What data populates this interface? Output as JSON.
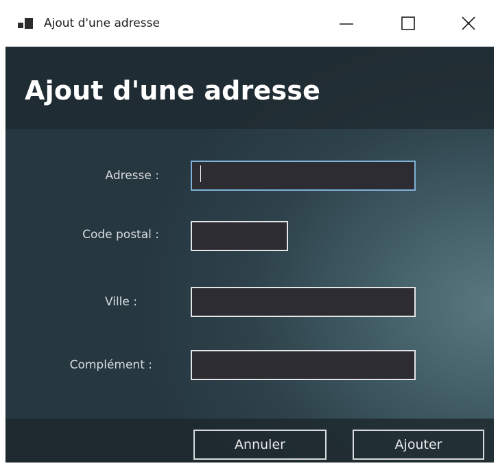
{
  "window": {
    "title": "Ajout d'une adresse",
    "icon": "app-window-icon",
    "controls": {
      "minimize": "minimize-icon",
      "maximize": "maximize-icon",
      "close": "close-icon"
    }
  },
  "header": {
    "title": "Ajout d'une adresse"
  },
  "form": {
    "address_label": "Adresse :",
    "address_value": "",
    "postal_label": "Code postal :",
    "postal_value": "",
    "city_label": "Ville :",
    "city_value": "",
    "complement_label": "Complément :",
    "complement_value": ""
  },
  "footer": {
    "cancel_label": "Annuler",
    "add_label": "Ajouter"
  },
  "colors": {
    "field_background": "#2d2c33",
    "focus_border": "#7fb2d6",
    "header_band": "#1e282e"
  }
}
